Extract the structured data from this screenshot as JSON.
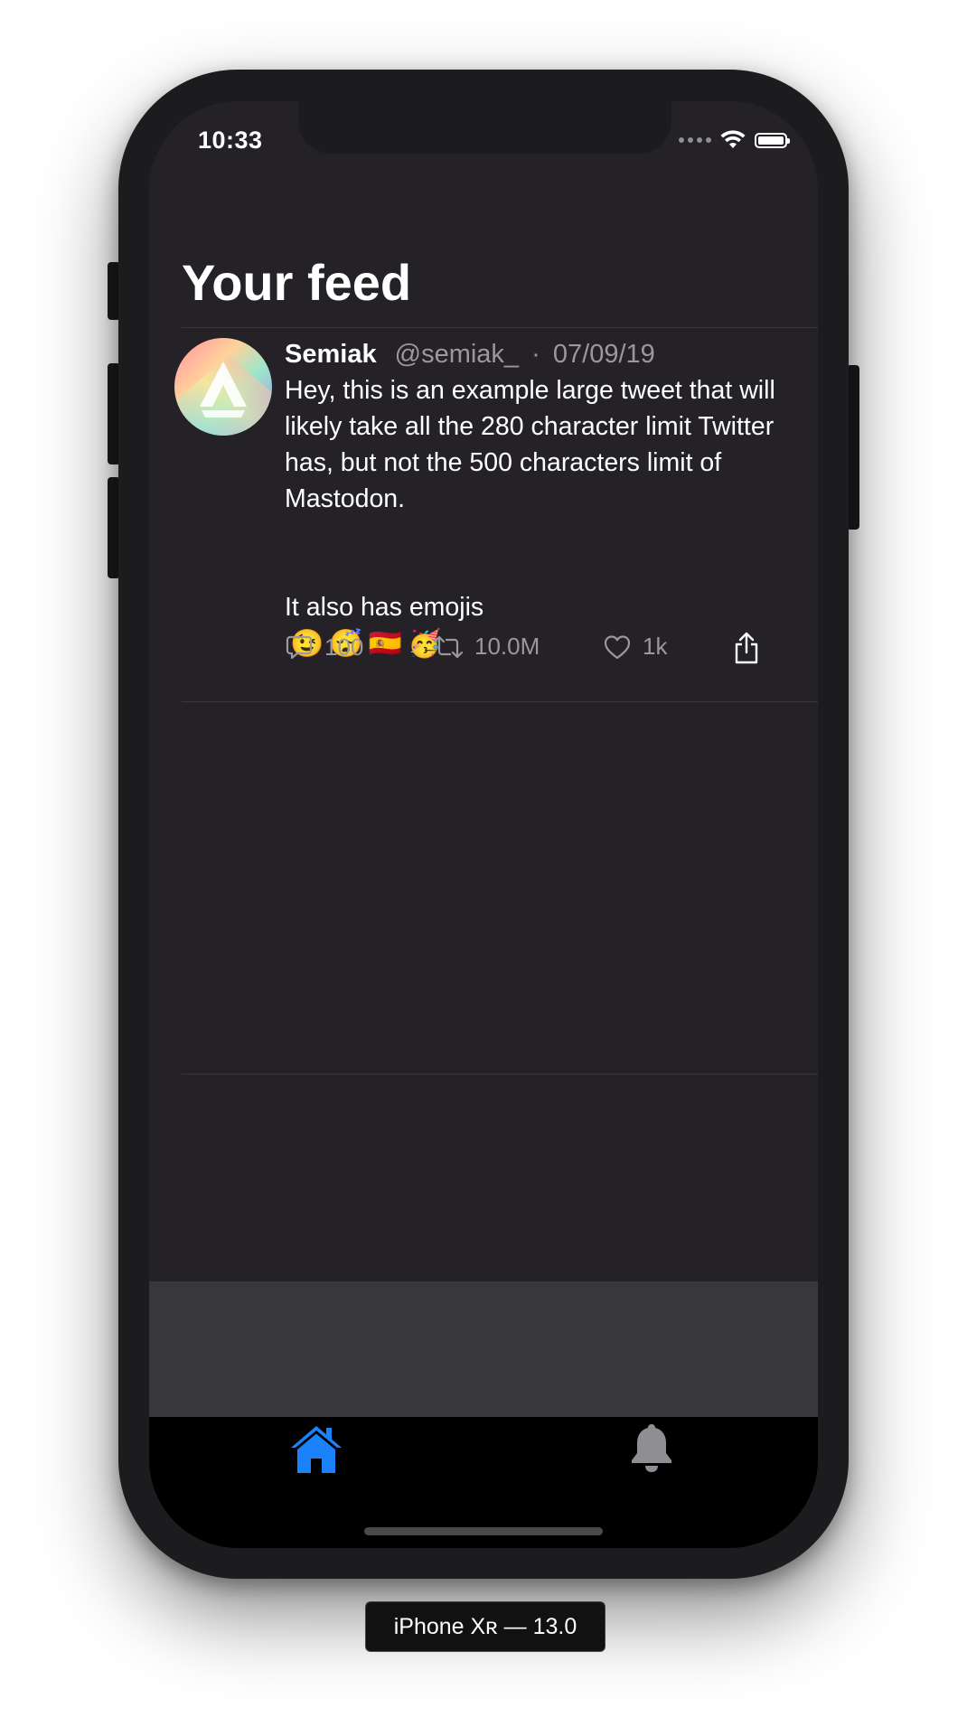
{
  "status_bar": {
    "time": "10:33"
  },
  "feed": {
    "title": "Your feed"
  },
  "tweet": {
    "author_name": "Semiak",
    "handle": "@semiak_",
    "separator": "·",
    "date": "07/09/19",
    "text": "Hey, this is an example large tweet that will likely take all the 280 character limit Twitter has, but not the 500 characters limit of Mastodon.",
    "text_line2": "It also has emojis",
    "emojis": [
      "😉",
      "😴",
      "🇪🇸",
      "🥳"
    ],
    "replies": "100",
    "retweets": "10.0M",
    "likes": "1k"
  },
  "tabbar": {
    "active_tab": "home",
    "active_color": "#1a82fb",
    "inactive_color": "#8e8e93"
  },
  "device_label": "iPhone Xʀ — 13.0"
}
